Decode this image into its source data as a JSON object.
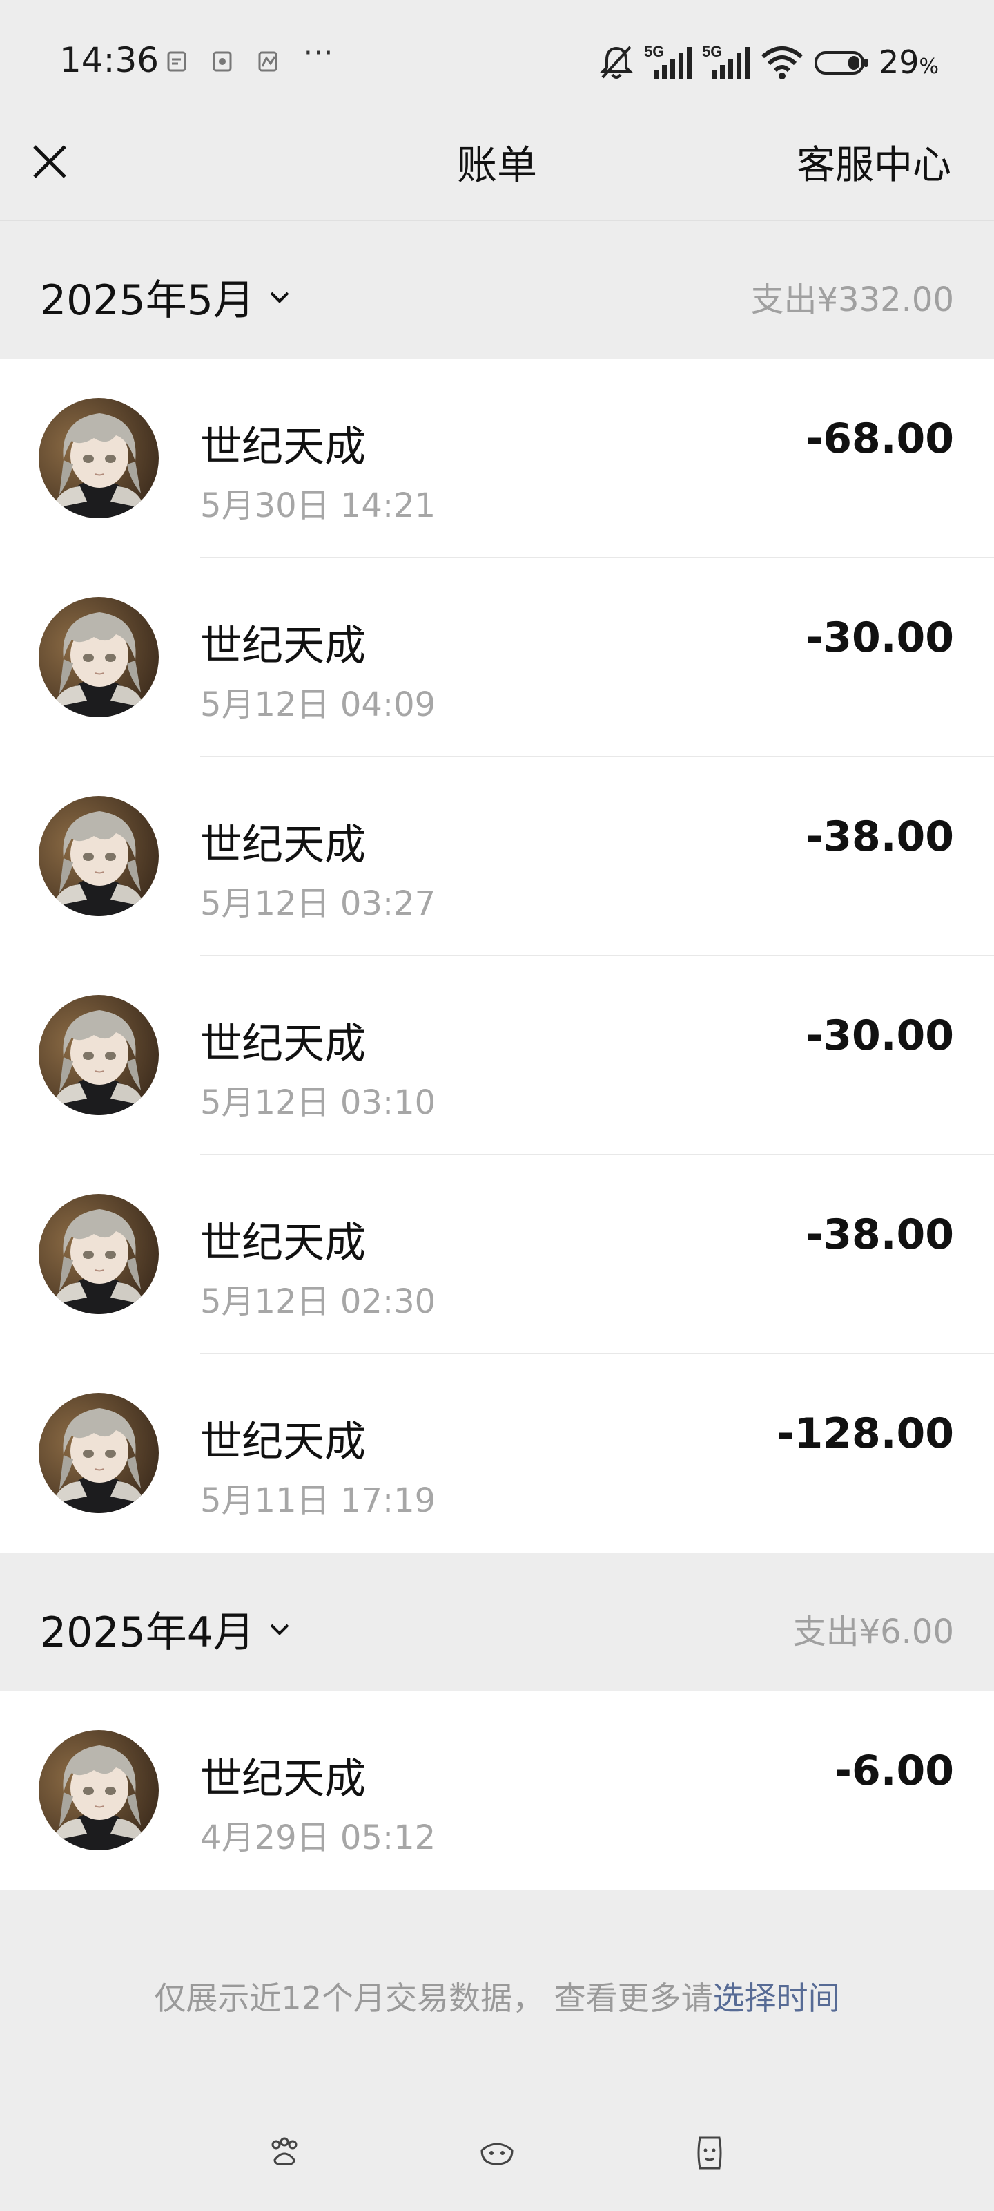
{
  "status_bar": {
    "time": "14:36",
    "dots": "···",
    "battery_percent": "29",
    "battery_unit": "%",
    "network_1": "5G",
    "network_2": "5G",
    "icons": [
      "notification-icon",
      "notification-icon",
      "notification-icon",
      "mute-bell-icon",
      "signal-icon",
      "wifi-icon",
      "battery-icon"
    ]
  },
  "navbar": {
    "title": "账单",
    "service": "客服中心"
  },
  "months": [
    {
      "label": "2025年5月",
      "expense": "支出¥332.00",
      "transactions": [
        {
          "title": "世纪天成",
          "time": "5月30日 14:21",
          "amount": "-68.00"
        },
        {
          "title": "世纪天成",
          "time": "5月12日 04:09",
          "amount": "-30.00"
        },
        {
          "title": "世纪天成",
          "time": "5月12日 03:27",
          "amount": "-38.00"
        },
        {
          "title": "世纪天成",
          "time": "5月12日 03:10",
          "amount": "-30.00"
        },
        {
          "title": "世纪天成",
          "time": "5月12日 02:30",
          "amount": "-38.00"
        },
        {
          "title": "世纪天成",
          "time": "5月11日 17:19",
          "amount": "-128.00"
        }
      ]
    },
    {
      "label": "2025年4月",
      "expense": "支出¥6.00",
      "transactions": [
        {
          "title": "世纪天成",
          "time": "4月29日 05:12",
          "amount": "-6.00"
        }
      ]
    }
  ],
  "footer": {
    "note": "仅展示近12个月交易数据， 查看更多请",
    "link": "选择时间"
  },
  "colors": {
    "background": "#ededed",
    "card": "#ffffff",
    "link": "#576b95",
    "muted": "#a6a6a6"
  }
}
